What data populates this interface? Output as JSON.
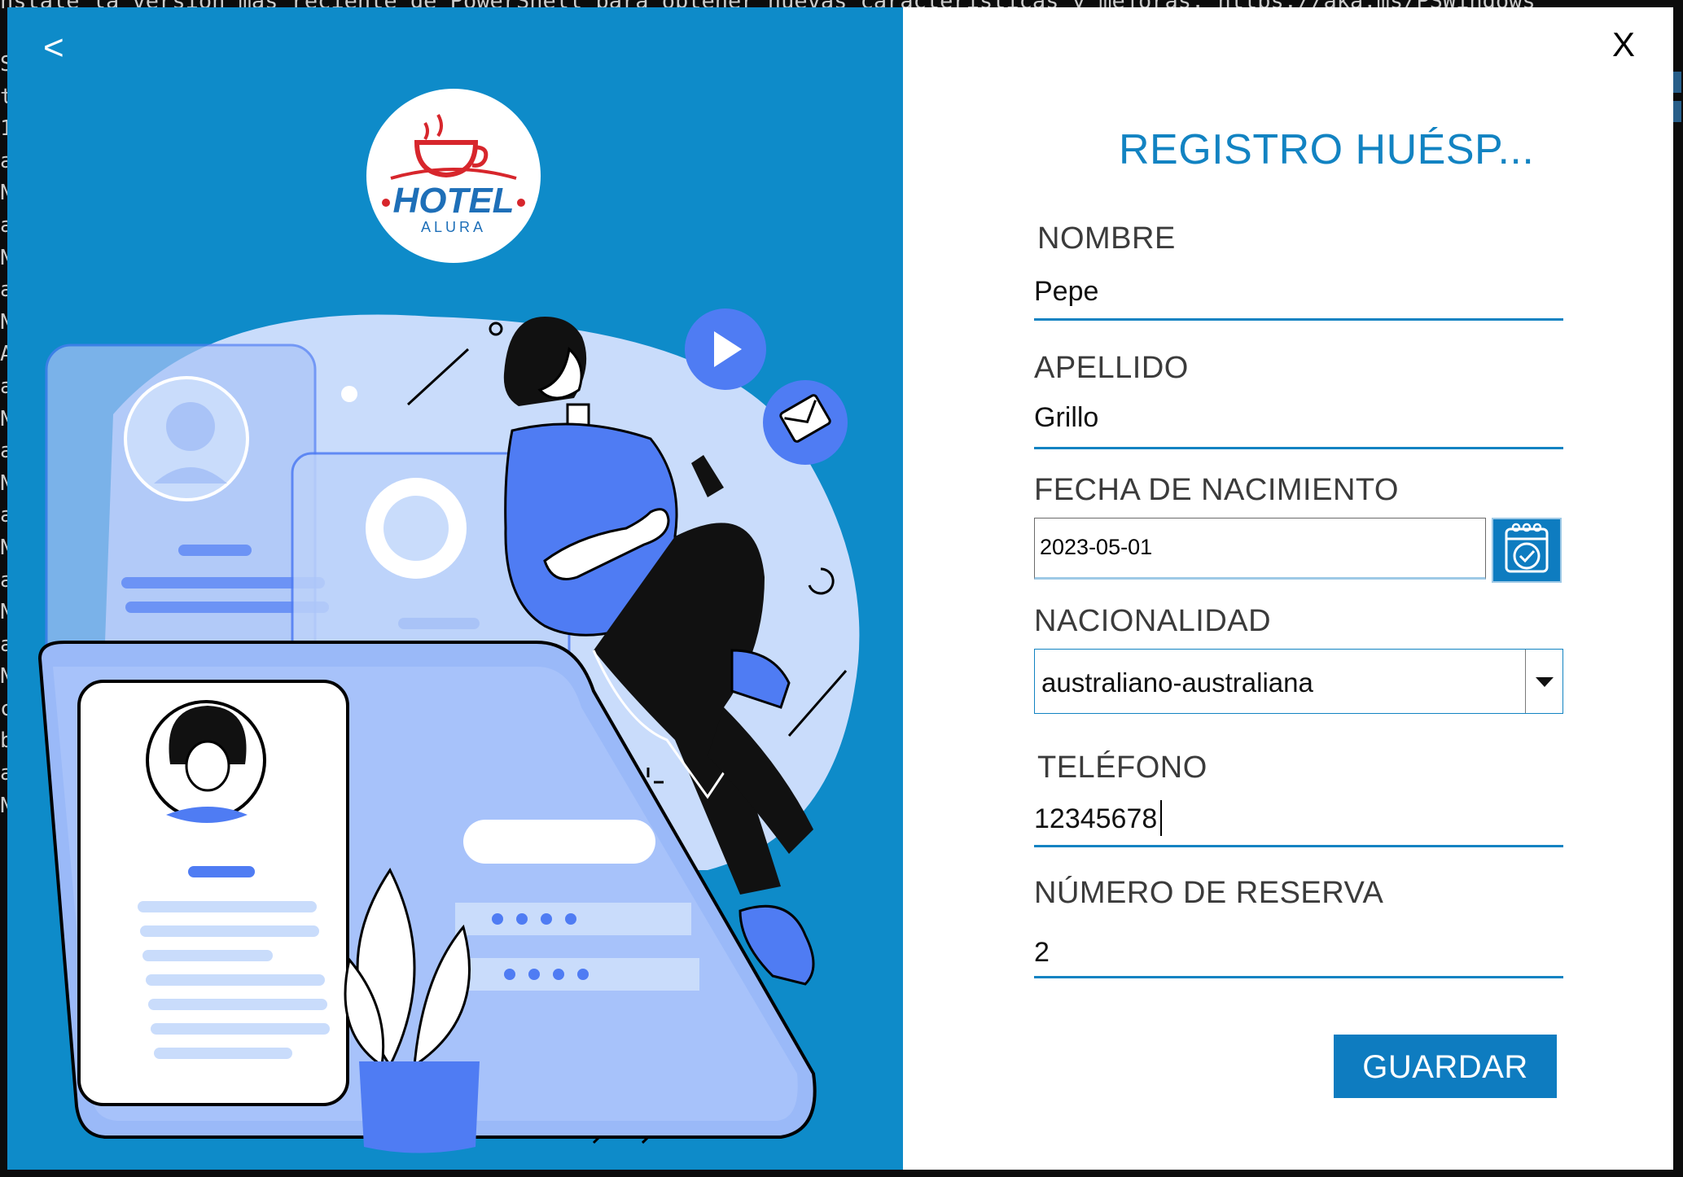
{
  "terminal": {
    "top_line": "nstale la versión más reciente de PowerShell para obtener nuevas características y mejoras. https://aka.ms/PSWindows",
    "gutter_chars": [
      "S",
      "t",
      "1",
      "a",
      "N",
      "a",
      "N",
      "a",
      "N",
      "A",
      "a",
      "N",
      "a",
      "N",
      "a",
      "N",
      "a",
      "N",
      "a",
      "N",
      "c",
      "b",
      "a",
      "N"
    ]
  },
  "window": {
    "back_label": "<",
    "close_label": "X",
    "title": "REGISTRO HUÉSP...",
    "logo_text": "HOTEL",
    "logo_subtext": "ALURA"
  },
  "form": {
    "nombre": {
      "label": "NOMBRE",
      "value": "Pepe"
    },
    "apellido": {
      "label": "APELLIDO",
      "value": "Grillo"
    },
    "fecha": {
      "label": "FECHA DE NACIMIENTO",
      "value": "2023-05-01"
    },
    "nacionalidad": {
      "label": "NACIONALIDAD",
      "value": "australiano-australiana"
    },
    "telefono": {
      "label": "TELÉFONO",
      "value": "12345678"
    },
    "reserva": {
      "label": "NÚMERO DE RESERVA",
      "value": "2"
    },
    "save_label": "GUARDAR"
  },
  "colors": {
    "panel_blue": "#0e8bc9",
    "accent_blue": "#1283c2",
    "button_blue": "#0e7cc0",
    "illustration_blue": "#4f7cf3",
    "illustration_light": "#c9dcfb"
  },
  "icons": [
    "back-icon",
    "close-icon",
    "calendar-icon",
    "dropdown-arrow-icon",
    "play-icon",
    "mail-icon"
  ]
}
